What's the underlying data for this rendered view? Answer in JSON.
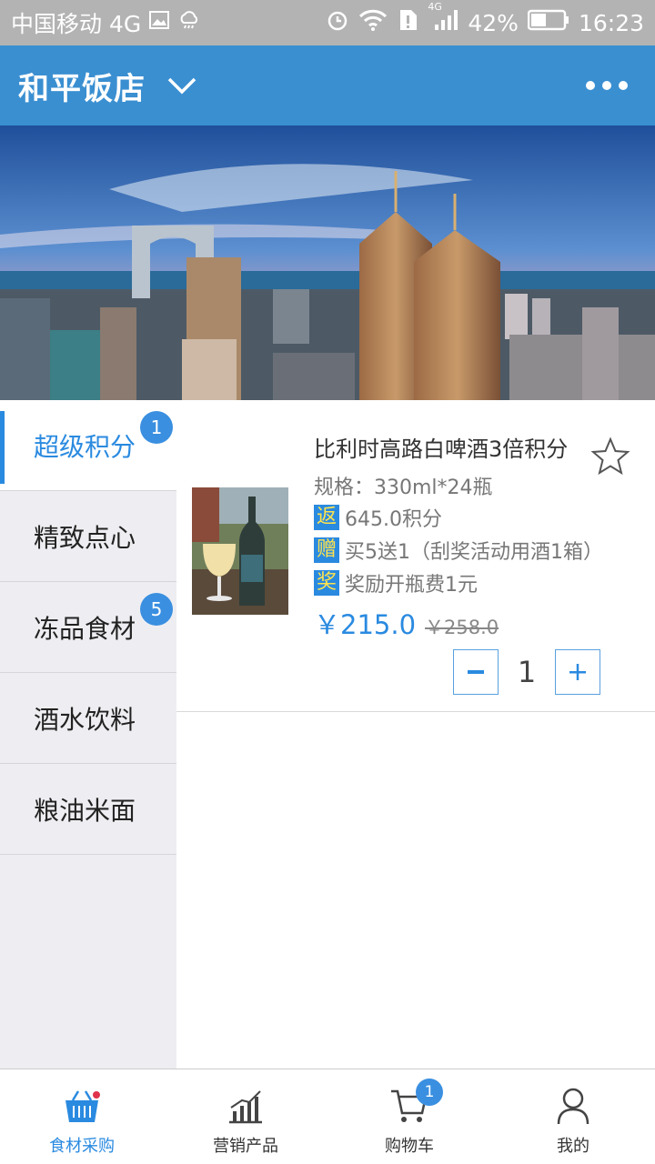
{
  "status_bar": {
    "carrier": "中国移动 4G",
    "network": "4G",
    "battery": "42%",
    "time": "16:23"
  },
  "header": {
    "store_name": "和平饭店"
  },
  "categories": [
    {
      "label": "超级积分",
      "badge": "1"
    },
    {
      "label": "精致点心",
      "badge": ""
    },
    {
      "label": "冻品食材",
      "badge": "5"
    },
    {
      "label": "酒水饮料",
      "badge": ""
    },
    {
      "label": "粮油米面",
      "badge": ""
    }
  ],
  "product": {
    "name": "比利时高路白啤酒3倍积分",
    "spec": "规格：330ml*24瓶",
    "tags": [
      {
        "tag": "返",
        "text": "645.0积分"
      },
      {
        "tag": "赠",
        "text": "买5送1（刮奖活动用酒1箱）"
      },
      {
        "tag": "奖",
        "text": "奖励开瓶费1元"
      }
    ],
    "price": "￥215.0",
    "original_price": "￥258.0",
    "quantity": "1",
    "minus": "−",
    "plus": "+"
  },
  "bottom_nav": [
    {
      "label": "食材采购",
      "icon": "basket-icon"
    },
    {
      "label": "营销产品",
      "icon": "chart-icon"
    },
    {
      "label": "购物车",
      "icon": "cart-icon",
      "badge": "1"
    },
    {
      "label": "我的",
      "icon": "user-icon"
    }
  ],
  "colors": {
    "accent": "#2a8ae0",
    "header_bg": "#3a8fd1",
    "tag_text": "#ffe34d"
  }
}
